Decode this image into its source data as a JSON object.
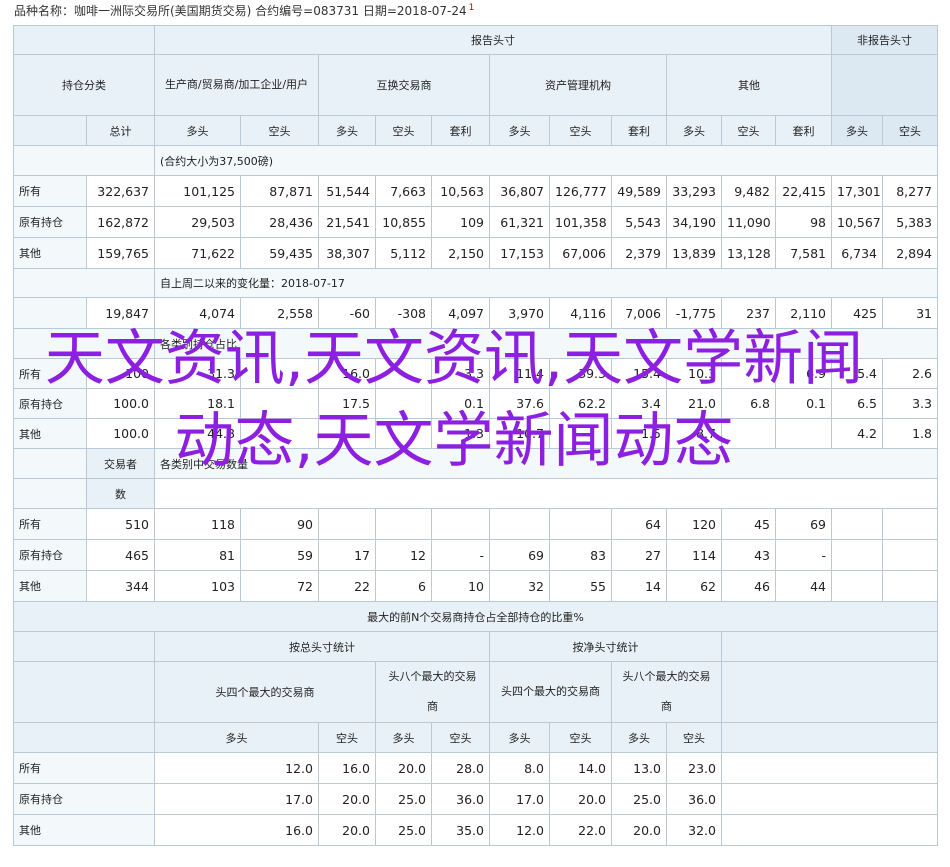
{
  "caption": {
    "text": "品种名称：咖啡一洲际交易所(美国期货交易) 合约编号=083731 日期=2018-07-24",
    "mark": "1"
  },
  "headers": {
    "reportable": "报告头寸",
    "nonreportable": "非报告头寸",
    "position_class": "持仓分类",
    "producer": "生产商/贸易商/加工企业/用户",
    "swap": "互换交易商",
    "managed_money": "资产管理机构",
    "other": "其他",
    "total": "总计",
    "long": "多头",
    "short": "空头",
    "spread": "套利"
  },
  "section1": {
    "banner": "(合约大小为37,500磅)",
    "rows": [
      {
        "label": "所有",
        "values": [
          "322,637",
          "101,125",
          "87,871",
          "51,544",
          "7,663",
          "10,563",
          "36,807",
          "126,777",
          "49,589",
          "33,293",
          "9,482",
          "22,415",
          "17,301",
          "8,277"
        ]
      },
      {
        "label": "原有持仓",
        "values": [
          "162,872",
          "29,503",
          "28,436",
          "21,541",
          "10,855",
          "109",
          "61,321",
          "101,358",
          "5,543",
          "34,190",
          "11,090",
          "98",
          "10,567",
          "5,383"
        ]
      },
      {
        "label": "其他",
        "values": [
          "159,765",
          "71,622",
          "59,435",
          "38,307",
          "5,112",
          "2,150",
          "17,153",
          "67,006",
          "2,379",
          "13,839",
          "13,128",
          "7,581",
          "6,734",
          "2,894"
        ]
      }
    ]
  },
  "section2": {
    "banner": "自上周二以来的变化量：2018-07-17",
    "values": [
      "19,847",
      "4,074",
      "2,558",
      "-60",
      "-308",
      "4,097",
      "3,970",
      "4,116",
      "7,006",
      "-1,775",
      "237",
      "2,110",
      "425",
      "31"
    ]
  },
  "section3": {
    "banner": "各类别持仓占比",
    "rows": [
      {
        "label": "所有",
        "values": [
          "100",
          "31.3",
          "",
          "16.0",
          "",
          "3.3",
          "11.4",
          "39.3",
          "15.4",
          "10.3",
          "",
          "6.9",
          "5.4",
          "2.6"
        ]
      },
      {
        "label": "原有持仓",
        "values": [
          "100.0",
          "18.1",
          "",
          "17.5",
          "",
          "0.1",
          "37.6",
          "62.2",
          "3.4",
          "21.0",
          "6.8",
          "0.1",
          "6.5",
          "3.3"
        ]
      },
      {
        "label": "其他",
        "values": [
          "100.0",
          "44.8",
          "",
          "",
          "",
          "1.3",
          "10.7",
          "",
          "1.5",
          "8.7",
          "",
          "",
          "4.2",
          "1.8"
        ]
      }
    ]
  },
  "section4": {
    "head_line1": "交易者",
    "head_line2": "数",
    "banner": "各类别中交易数量",
    "rows": [
      {
        "label": "所有",
        "values": [
          "510",
          "118",
          "90",
          "",
          "",
          "",
          "",
          "",
          "64",
          "120",
          "45",
          "69",
          "",
          ""
        ]
      },
      {
        "label": "原有持仓",
        "values": [
          "465",
          "81",
          "59",
          "17",
          "12",
          "-",
          "69",
          "83",
          "27",
          "114",
          "43",
          "-",
          "",
          ""
        ]
      },
      {
        "label": "其他",
        "values": [
          "344",
          "103",
          "72",
          "22",
          "6",
          "10",
          "32",
          "55",
          "14",
          "62",
          "46",
          "44",
          "",
          ""
        ]
      }
    ]
  },
  "section5": {
    "title": "最大的前N个交易商持仓占全部持仓的比重%",
    "gross": "按总头寸统计",
    "net": "按净头寸统计",
    "top4": "头四个最大的交易商",
    "top8_a": "头八个最大的交易",
    "top8_b": "商",
    "rows": [
      {
        "label": "所有",
        "values": [
          "12.0",
          "16.0",
          "20.0",
          "28.0",
          "8.0",
          "14.0",
          "13.0",
          "23.0"
        ]
      },
      {
        "label": "原有持仓",
        "values": [
          "17.0",
          "20.0",
          "25.0",
          "36.0",
          "17.0",
          "20.0",
          "25.0",
          "36.0"
        ]
      },
      {
        "label": "其他",
        "values": [
          "16.0",
          "20.0",
          "25.0",
          "35.0",
          "12.0",
          "22.0",
          "20.0",
          "32.0"
        ]
      }
    ]
  },
  "overlay": {
    "text": "天文资讯,天文资讯,天文学新闻动态,天文学新闻动态",
    "color": "#8c1fe0"
  }
}
